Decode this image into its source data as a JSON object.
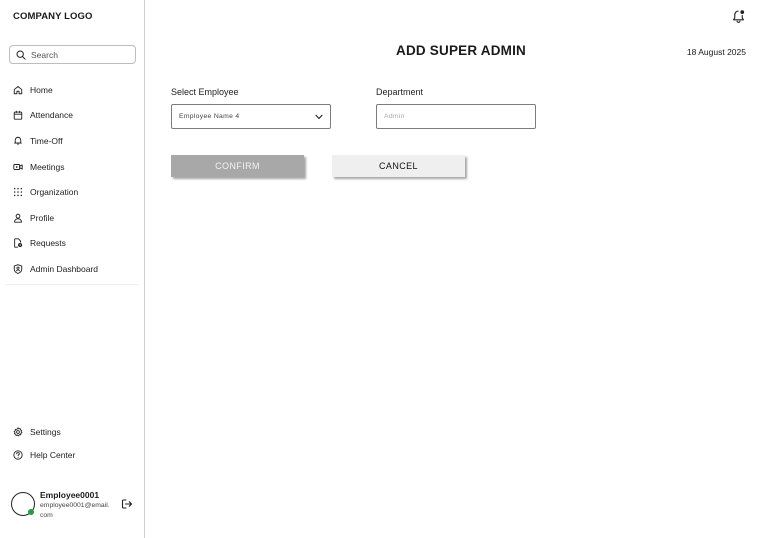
{
  "sidebar": {
    "logo": "COMPANY LOGO",
    "search": {
      "placeholder": "Search",
      "icon": "search-icon"
    },
    "items": [
      {
        "label": "Home",
        "icon": "home-icon"
      },
      {
        "label": "Attendance",
        "icon": "calendar-icon"
      },
      {
        "label": "Time-Off",
        "icon": "umbrella-icon"
      },
      {
        "label": "Meetings",
        "icon": "video-icon"
      },
      {
        "label": "Organization",
        "icon": "grid-icon"
      },
      {
        "label": "Profile",
        "icon": "user-icon"
      },
      {
        "label": "Requests",
        "icon": "document-clock-icon"
      },
      {
        "label": "Admin Dashboard",
        "icon": "shield-user-icon"
      }
    ],
    "bottom_items": [
      {
        "label": "Settings",
        "icon": "gear-icon"
      },
      {
        "label": "Help Center",
        "icon": "help-icon"
      }
    ],
    "user": {
      "name": "Employee0001",
      "email": "employee0001@email.com",
      "status_color": "#1e9e3f"
    }
  },
  "header": {
    "title": "ADD SUPER ADMIN",
    "date": "18 August 2025"
  },
  "form": {
    "employee_label": "Select Employee",
    "employee_value": "Employee Name 4",
    "department_label": "Department",
    "department_placeholder": "Admin",
    "confirm_label": "CONFIRM",
    "cancel_label": "CANCEL"
  },
  "colors": {
    "confirm_bg": "#a8a8a8",
    "cancel_bg": "#efefef",
    "divider": "#cfcfcf"
  }
}
